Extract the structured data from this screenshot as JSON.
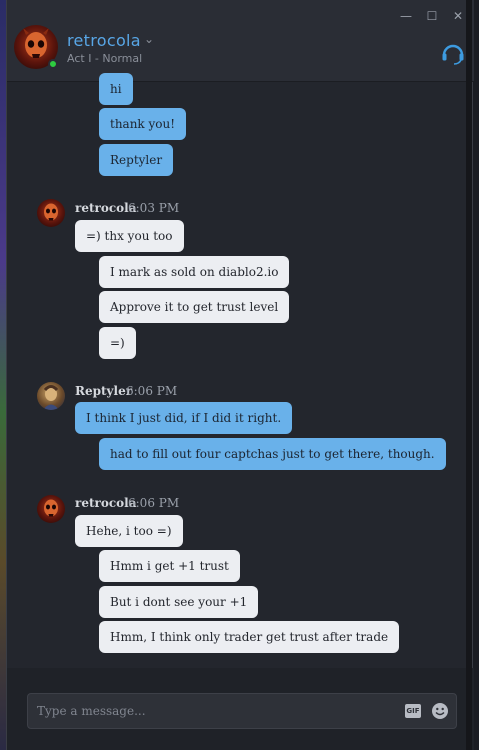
{
  "window": {
    "minimize_glyph": "—",
    "maximize_glyph": "☐",
    "close_glyph": "✕"
  },
  "header": {
    "username": "retrocola",
    "status": "Act I - Normal",
    "online_color": "#2ecc40",
    "accent_color": "#58a6e6",
    "headset_icon": "headset-icon"
  },
  "messages": {
    "group0": {
      "b1": "hi",
      "b2": "thank you!",
      "b3": "Reptyler"
    },
    "group1": {
      "name": "retrocola",
      "time": "6:03 PM",
      "b1": "=) thx you too",
      "b2": "I mark as sold on diablo2.io",
      "b3": "Approve it to get trust level",
      "b4": "=)"
    },
    "group2": {
      "name": "Reptyler",
      "time": "6:06 PM",
      "b1": "I think I just did, if I did it right.",
      "b2": "had to fill out four captchas just to get there, though."
    },
    "group3": {
      "name": "retrocola",
      "time": "6:06 PM",
      "b1": "Hehe, i too =)",
      "b2": "Hmm i get +1 trust",
      "b3": "But i dont see your +1",
      "b4": "Hmm, I think only trader get trust after trade"
    }
  },
  "composer": {
    "placeholder": "Type a message...",
    "gif_label": "GIF",
    "emoji_icon": "emoji-icon"
  },
  "colors": {
    "own_bubble": "#69b1ea",
    "other_bubble": "#eceef2",
    "background": "#23262d"
  }
}
